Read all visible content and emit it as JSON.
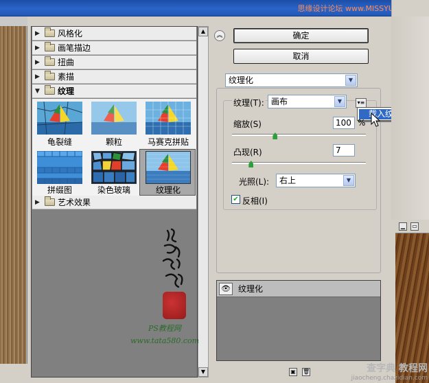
{
  "watermark_top": "思缘设计论坛 www.MISSYUAN.COM",
  "filter_categories": [
    {
      "label": "风格化",
      "expanded": false
    },
    {
      "label": "画笔描边",
      "expanded": false
    },
    {
      "label": "扭曲",
      "expanded": false
    },
    {
      "label": "素描",
      "expanded": false
    },
    {
      "label": "纹理",
      "expanded": true
    },
    {
      "label": "艺术效果",
      "expanded": false
    }
  ],
  "texture_filters": [
    {
      "label": "龟裂缝"
    },
    {
      "label": "颗粒"
    },
    {
      "label": "马赛克拼贴"
    },
    {
      "label": "拼缀图"
    },
    {
      "label": "染色玻璃"
    },
    {
      "label": "纹理化",
      "selected": true
    }
  ],
  "buttons": {
    "ok": "确定",
    "cancel": "取消"
  },
  "filter_select": {
    "value": "纹理化"
  },
  "texture": {
    "label": "纹理(T):",
    "value": "画布",
    "menu_item": "载入纹理..."
  },
  "scale": {
    "label": "缩放(S)",
    "value": "100",
    "unit": "%",
    "slider_fraction": 0.32
  },
  "relief": {
    "label": "凸现(R)",
    "value": "7",
    "slider_fraction": 0.14
  },
  "light": {
    "label": "光照(L):",
    "value": "右上"
  },
  "invert": {
    "label": "反相(I)",
    "checked": true
  },
  "layers": [
    {
      "name": "纹理化",
      "visible": true
    }
  ],
  "calligraphy": "他她我帮你",
  "ps_watermark": "PS教程网",
  "ps_url": "www.tata580.com",
  "corner_watermark": {
    "title": "查字典 教程网",
    "url": "jiaocheng.chazidian.com"
  },
  "icons": {
    "collapse": "double-chevron-up-icon",
    "eye": "eye-icon",
    "new_layer": "new-layer-icon",
    "trash": "trash-icon",
    "folder": "folder-icon"
  }
}
